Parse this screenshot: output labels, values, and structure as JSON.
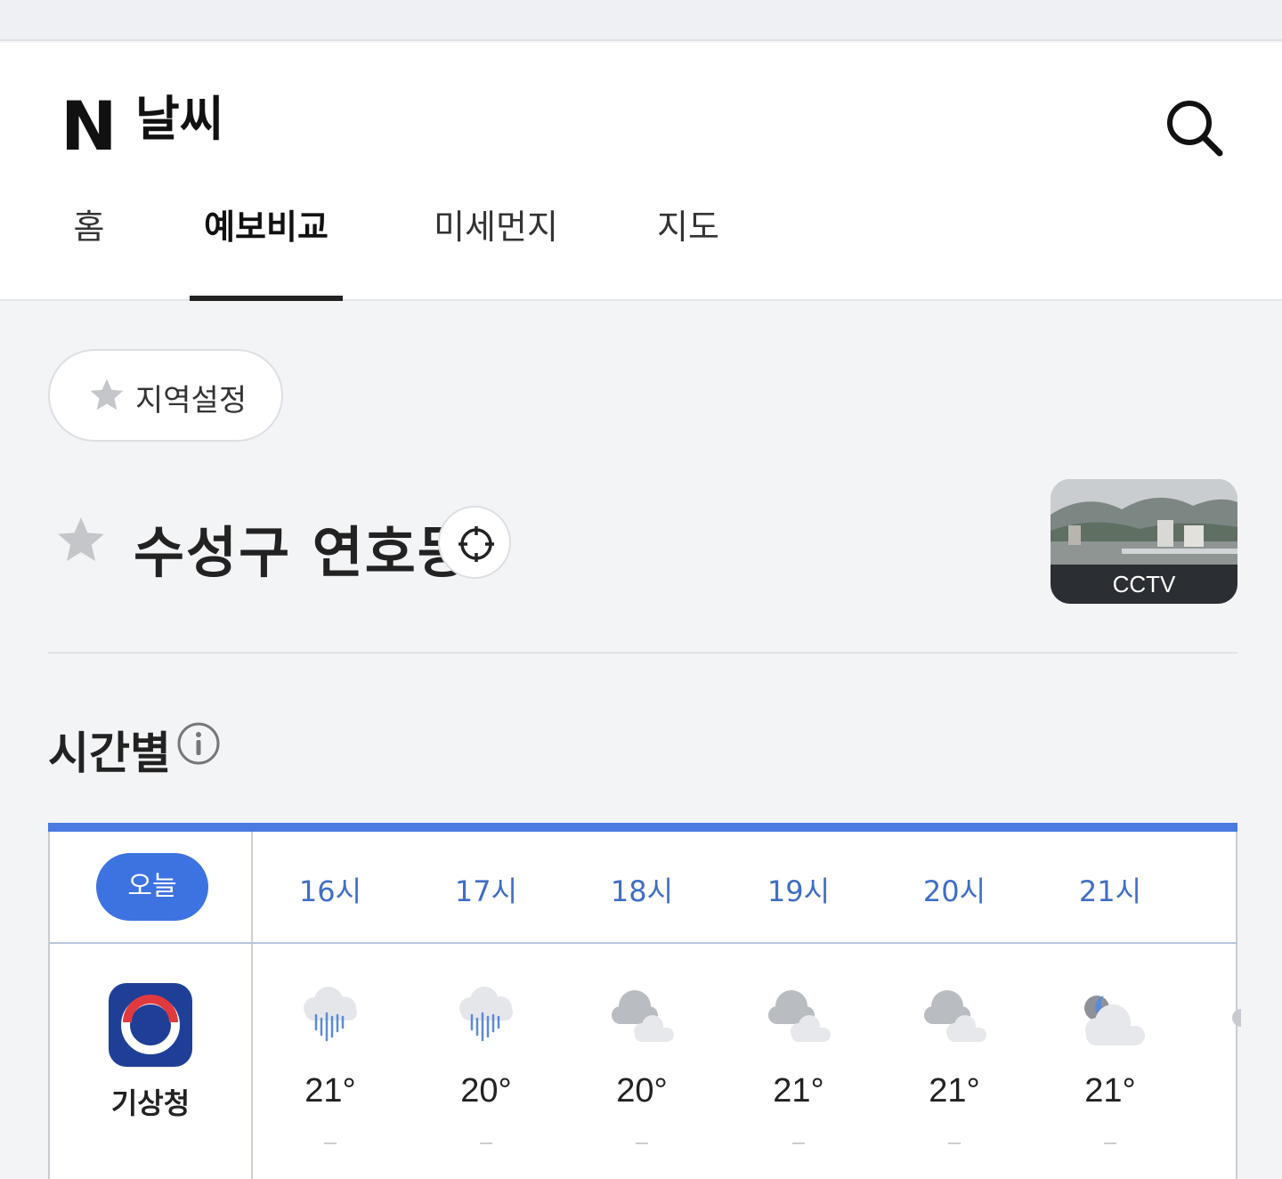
{
  "header": {
    "logo_letter": "N",
    "logo_text": "날씨",
    "search_icon": "search-icon"
  },
  "tabs": [
    {
      "label": "홈",
      "active": false
    },
    {
      "label": "예보비교",
      "active": true
    },
    {
      "label": "미세먼지",
      "active": false
    },
    {
      "label": "지도",
      "active": false
    }
  ],
  "region_button": {
    "label": "지역설정",
    "icon": "star-icon"
  },
  "location": {
    "name": "수성구 연호동",
    "star_icon": "star-icon",
    "gps_icon": "crosshair-icon"
  },
  "cctv": {
    "label": "CCTV"
  },
  "hourly": {
    "title": "시간별",
    "info_icon": "info-icon",
    "today_label": "오늘",
    "accent_color": "#3d73e0",
    "hours": [
      "16시",
      "17시",
      "18시",
      "19시",
      "20시",
      "21시"
    ],
    "provider": {
      "name": "기상청",
      "icon": "kma-logo"
    },
    "forecasts": [
      {
        "icon": "rain-icon",
        "temp": "21°",
        "precip": "-"
      },
      {
        "icon": "rain-icon",
        "temp": "20°",
        "precip": "-"
      },
      {
        "icon": "cloudy-icon",
        "temp": "20°",
        "precip": "-"
      },
      {
        "icon": "cloudy-icon",
        "temp": "21°",
        "precip": "-"
      },
      {
        "icon": "cloudy-icon",
        "temp": "21°",
        "precip": "-"
      },
      {
        "icon": "cloudy-night-icon",
        "temp": "21°",
        "precip": "-"
      }
    ]
  }
}
